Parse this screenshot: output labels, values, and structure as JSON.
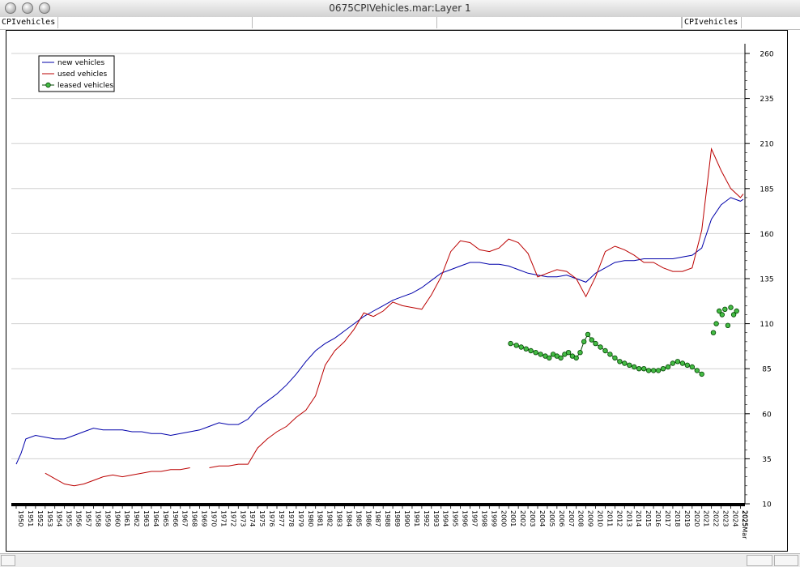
{
  "window": {
    "title": "0675CPIVehicles.mar:Layer 1",
    "left_tab": "CPIvehicles",
    "right_tab": "CPIvehicles"
  },
  "colors": {
    "new": "#0000aa",
    "used": "#bb0000",
    "leased_fill": "#44bb44",
    "leased_stroke": "#004400"
  },
  "chart_data": {
    "type": "line",
    "title": "",
    "xlabel": "",
    "ylabel": "",
    "xlim": [
      1950,
      2025.3
    ],
    "ylim": [
      10,
      260
    ],
    "y_ticks": [
      10,
      35,
      60,
      85,
      110,
      135,
      160,
      185,
      210,
      235,
      260
    ],
    "y_axis_side": "right",
    "grid": "horizontal",
    "legend_position": "top-left",
    "x_tick_labels": [
      "1950",
      "1951",
      "1952",
      "1953",
      "1954",
      "1955",
      "1956",
      "1957",
      "1958",
      "1959",
      "1960",
      "1961",
      "1962",
      "1963",
      "1964",
      "1965",
      "1966",
      "1967",
      "1968",
      "1969",
      "1970",
      "1971",
      "1972",
      "1973",
      "1974",
      "1975",
      "1976",
      "1977",
      "1978",
      "1979",
      "1980",
      "1981",
      "1982",
      "1983",
      "1984",
      "1985",
      "1986",
      "1987",
      "1988",
      "1989",
      "1990",
      "1991",
      "1992",
      "1993",
      "1994",
      "1995",
      "1996",
      "1997",
      "1998",
      "1999",
      "2000",
      "2001",
      "2002",
      "2003",
      "2004",
      "2005",
      "2006",
      "2007",
      "2008",
      "2009",
      "2010",
      "2011",
      "2012",
      "2013",
      "2014",
      "2015",
      "2016",
      "2017",
      "2018",
      "2019",
      "2020",
      "2021",
      "2022",
      "2023",
      "2024",
      "2025"
    ],
    "last_x_label": "2025Mar",
    "series": [
      {
        "name": "new vehicles",
        "style": "line",
        "points": [
          [
            1950,
            32
          ],
          [
            1950.5,
            38
          ],
          [
            1951,
            46
          ],
          [
            1952,
            48
          ],
          [
            1953,
            47
          ],
          [
            1954,
            46
          ],
          [
            1955,
            46
          ],
          [
            1956,
            48
          ],
          [
            1957,
            50
          ],
          [
            1958,
            52
          ],
          [
            1959,
            51
          ],
          [
            1960,
            51
          ],
          [
            1961,
            51
          ],
          [
            1962,
            50
          ],
          [
            1963,
            50
          ],
          [
            1964,
            49
          ],
          [
            1965,
            49
          ],
          [
            1966,
            48
          ],
          [
            1967,
            49
          ],
          [
            1968,
            50
          ],
          [
            1969,
            51
          ],
          [
            1970,
            53
          ],
          [
            1971,
            55
          ],
          [
            1972,
            54
          ],
          [
            1973,
            54
          ],
          [
            1974,
            57
          ],
          [
            1975,
            63
          ],
          [
            1976,
            67
          ],
          [
            1977,
            71
          ],
          [
            1978,
            76
          ],
          [
            1979,
            82
          ],
          [
            1980,
            89
          ],
          [
            1981,
            95
          ],
          [
            1982,
            99
          ],
          [
            1983,
            102
          ],
          [
            1984,
            106
          ],
          [
            1985,
            110
          ],
          [
            1986,
            114
          ],
          [
            1987,
            117
          ],
          [
            1988,
            120
          ],
          [
            1989,
            123
          ],
          [
            1990,
            125
          ],
          [
            1991,
            127
          ],
          [
            1992,
            130
          ],
          [
            1993,
            134
          ],
          [
            1994,
            138
          ],
          [
            1995,
            140
          ],
          [
            1996,
            142
          ],
          [
            1997,
            144
          ],
          [
            1998,
            144
          ],
          [
            1999,
            143
          ],
          [
            2000,
            143
          ],
          [
            2001,
            142
          ],
          [
            2002,
            140
          ],
          [
            2003,
            138
          ],
          [
            2004,
            137
          ],
          [
            2005,
            136
          ],
          [
            2006,
            136
          ],
          [
            2007,
            137
          ],
          [
            2008,
            135
          ],
          [
            2009,
            133
          ],
          [
            2010,
            138
          ],
          [
            2011,
            141
          ],
          [
            2012,
            144
          ],
          [
            2013,
            145
          ],
          [
            2014,
            145
          ],
          [
            2015,
            146
          ],
          [
            2016,
            146
          ],
          [
            2017,
            146
          ],
          [
            2018,
            146
          ],
          [
            2019,
            147
          ],
          [
            2020,
            148
          ],
          [
            2021,
            152
          ],
          [
            2022,
            168
          ],
          [
            2023,
            176
          ],
          [
            2024,
            180
          ],
          [
            2025,
            178
          ],
          [
            2025.3,
            179
          ]
        ]
      },
      {
        "name": "used vehicles",
        "style": "line",
        "points": [
          [
            1953,
            27
          ],
          [
            1954,
            24
          ],
          [
            1955,
            21
          ],
          [
            1956,
            20
          ],
          [
            1957,
            21
          ],
          [
            1958,
            23
          ],
          [
            1959,
            25
          ],
          [
            1960,
            26
          ],
          [
            1961,
            25
          ],
          [
            1962,
            26
          ],
          [
            1963,
            27
          ],
          [
            1964,
            28
          ],
          [
            1965,
            28
          ],
          [
            1966,
            29
          ],
          [
            1967,
            29
          ],
          [
            1968,
            30
          ],
          [
            1969,
            null
          ],
          [
            1970,
            30
          ],
          [
            1971,
            31
          ],
          [
            1972,
            31
          ],
          [
            1973,
            32
          ],
          [
            1974,
            32
          ],
          [
            1975,
            41
          ],
          [
            1976,
            46
          ],
          [
            1977,
            50
          ],
          [
            1978,
            53
          ],
          [
            1979,
            58
          ],
          [
            1980,
            62
          ],
          [
            1981,
            70
          ],
          [
            1982,
            87
          ],
          [
            1983,
            95
          ],
          [
            1984,
            100
          ],
          [
            1985,
            107
          ],
          [
            1986,
            116
          ],
          [
            1987,
            114
          ],
          [
            1988,
            117
          ],
          [
            1989,
            122
          ],
          [
            1990,
            120
          ],
          [
            1991,
            119
          ],
          [
            1992,
            118
          ],
          [
            1993,
            126
          ],
          [
            1994,
            136
          ],
          [
            1995,
            150
          ],
          [
            1996,
            156
          ],
          [
            1997,
            155
          ],
          [
            1998,
            151
          ],
          [
            1999,
            150
          ],
          [
            2000,
            152
          ],
          [
            2001,
            157
          ],
          [
            2002,
            155
          ],
          [
            2003,
            149
          ],
          [
            2004,
            136
          ],
          [
            2005,
            138
          ],
          [
            2006,
            140
          ],
          [
            2007,
            139
          ],
          [
            2008,
            135
          ],
          [
            2009,
            125
          ],
          [
            2010,
            136
          ],
          [
            2011,
            150
          ],
          [
            2012,
            153
          ],
          [
            2013,
            151
          ],
          [
            2014,
            148
          ],
          [
            2015,
            144
          ],
          [
            2016,
            144
          ],
          [
            2017,
            141
          ],
          [
            2018,
            139
          ],
          [
            2019,
            139
          ],
          [
            2020,
            141
          ],
          [
            2021,
            162
          ],
          [
            2022,
            207
          ],
          [
            2023,
            195
          ],
          [
            2024,
            185
          ],
          [
            2025,
            180
          ],
          [
            2025.3,
            182
          ]
        ]
      },
      {
        "name": "leased vehicles",
        "style": "markers-line",
        "points": [
          [
            2001.2,
            99
          ],
          [
            2001.8,
            98
          ],
          [
            2002.3,
            97
          ],
          [
            2002.8,
            96
          ],
          [
            2003.3,
            95
          ],
          [
            2003.8,
            94
          ],
          [
            2004.3,
            93
          ],
          [
            2004.8,
            92
          ],
          [
            2005.2,
            91
          ],
          [
            2005.6,
            93
          ],
          [
            2006,
            92
          ],
          [
            2006.4,
            91
          ],
          [
            2006.8,
            93
          ],
          [
            2007.2,
            94
          ],
          [
            2007.6,
            92
          ],
          [
            2008,
            91
          ],
          [
            2008.4,
            94
          ],
          [
            2008.8,
            100
          ],
          [
            2009.2,
            104
          ],
          [
            2009.6,
            101
          ],
          [
            2010,
            99
          ],
          [
            2010.5,
            97
          ],
          [
            2011,
            95
          ],
          [
            2011.5,
            93
          ],
          [
            2012,
            91
          ],
          [
            2012.5,
            89
          ],
          [
            2013,
            88
          ],
          [
            2013.5,
            87
          ],
          [
            2014,
            86
          ],
          [
            2014.5,
            85
          ],
          [
            2015,
            85
          ],
          [
            2015.5,
            84
          ],
          [
            2016,
            84
          ],
          [
            2016.5,
            84
          ],
          [
            2017,
            85
          ],
          [
            2017.5,
            86
          ],
          [
            2018,
            88
          ],
          [
            2018.5,
            89
          ],
          [
            2019,
            88
          ],
          [
            2019.5,
            87
          ],
          [
            2020,
            86
          ],
          [
            2020.5,
            84
          ],
          [
            2021,
            82
          ],
          [
            2022.2,
            105
          ],
          [
            2022.5,
            110
          ],
          [
            2022.8,
            117
          ],
          [
            2023.1,
            115
          ],
          [
            2023.4,
            118
          ],
          [
            2023.7,
            109
          ],
          [
            2024,
            119
          ],
          [
            2024.3,
            115
          ],
          [
            2024.6,
            117
          ]
        ]
      }
    ]
  }
}
